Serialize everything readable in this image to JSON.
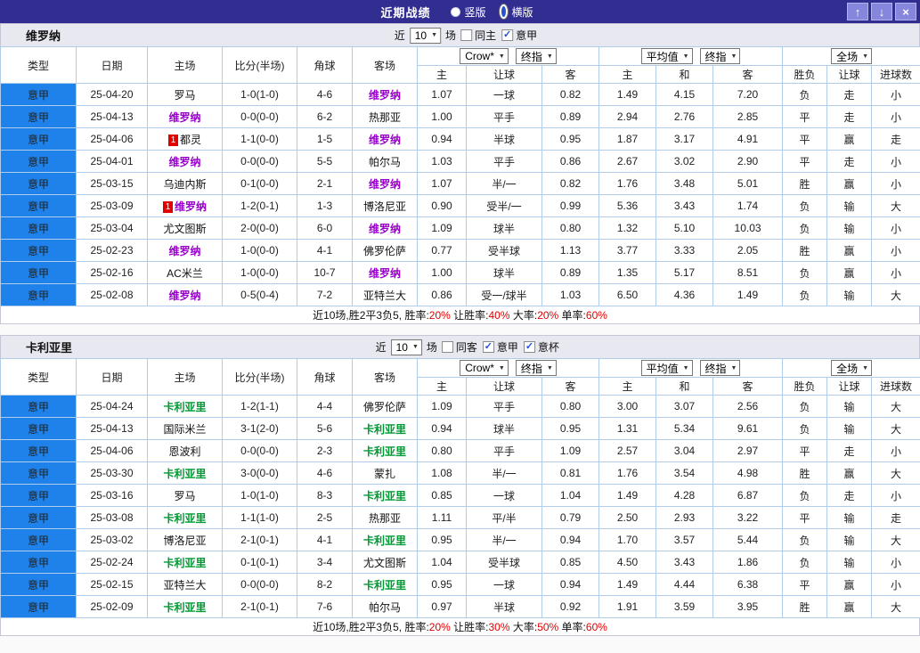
{
  "top_bar": {
    "title": "近期战绩",
    "view_options": [
      {
        "label": "竖版",
        "selected": false
      },
      {
        "label": "横版",
        "selected": true
      }
    ],
    "buttons": {
      "up": "↑",
      "down": "↓",
      "close": "×"
    }
  },
  "columns": [
    "类型",
    "日期",
    "主场",
    "比分(半场)",
    "角球",
    "客场"
  ],
  "subcols": [
    "主",
    "让球",
    "客",
    "主",
    "和",
    "客",
    "胜负",
    "让球",
    "进球数"
  ],
  "selects": {
    "bookmaker": "Crow*",
    "final": "终指",
    "average": "平均值",
    "full": "全场"
  },
  "colors": {
    "accent_blue": "#1e82ea",
    "score_red": "#e10000",
    "result_blue": "#2c46c8",
    "result_gold": "#c79100",
    "topbar": "#322e91"
  },
  "sections": [
    {
      "team": "维罗纳",
      "team_color": "#9900cc",
      "filter": {
        "prefix": "近",
        "count": "10",
        "suffix": "场",
        "checks": [
          {
            "label": "同主",
            "checked": false
          },
          {
            "label": "意甲",
            "checked": true
          }
        ]
      },
      "rows": [
        {
          "league": "意甲",
          "date": "25-04-20",
          "home": {
            "n": "罗马"
          },
          "score": "1-0(1-0)",
          "corner": "4-6",
          "away": {
            "n": "维罗纳",
            "hl": true
          },
          "asian": [
            "1.07",
            "一球",
            "0.82"
          ],
          "euro": [
            "1.49",
            "4.15",
            "7.20"
          ],
          "res": [
            [
              "负",
              "b"
            ],
            [
              "走",
              "b"
            ],
            [
              "小",
              "b"
            ]
          ]
        },
        {
          "league": "意甲",
          "date": "25-04-13",
          "home": {
            "n": "维罗纳",
            "hl": true
          },
          "score": "0-0(0-0)",
          "corner": "6-2",
          "away": {
            "n": "热那亚"
          },
          "asian": [
            "1.00",
            "平手",
            "0.89"
          ],
          "euro": [
            "2.94",
            "2.76",
            "2.85"
          ],
          "res": [
            [
              "平",
              "b"
            ],
            [
              "走",
              "b"
            ],
            [
              "小",
              "b"
            ]
          ]
        },
        {
          "league": "意甲",
          "date": "25-04-06",
          "home": {
            "n": "都灵",
            "badge": "1"
          },
          "score": "1-1(0-0)",
          "corner": "1-5",
          "away": {
            "n": "维罗纳",
            "hl": true
          },
          "asian": [
            "0.94",
            "半球",
            "0.95"
          ],
          "euro": [
            "1.87",
            "3.17",
            "4.91"
          ],
          "res": [
            [
              "平",
              "b"
            ],
            [
              "赢",
              "r"
            ],
            [
              "走",
              "g"
            ]
          ]
        },
        {
          "league": "意甲",
          "date": "25-04-01",
          "home": {
            "n": "维罗纳",
            "hl": true
          },
          "score": "0-0(0-0)",
          "corner": "5-5",
          "away": {
            "n": "帕尔马"
          },
          "asian": [
            "1.03",
            "平手",
            "0.86"
          ],
          "euro": [
            "2.67",
            "3.02",
            "2.90"
          ],
          "res": [
            [
              "平",
              "b"
            ],
            [
              "走",
              "b"
            ],
            [
              "小",
              "b"
            ]
          ]
        },
        {
          "league": "意甲",
          "date": "25-03-15",
          "home": {
            "n": "乌迪内斯"
          },
          "score": "0-1(0-0)",
          "corner": "2-1",
          "away": {
            "n": "维罗纳",
            "hl": true
          },
          "asian": [
            "1.07",
            "半/一",
            "0.82"
          ],
          "euro": [
            "1.76",
            "3.48",
            "5.01"
          ],
          "res": [
            [
              "胜",
              "r"
            ],
            [
              "赢",
              "r"
            ],
            [
              "小",
              "b"
            ]
          ]
        },
        {
          "league": "意甲",
          "date": "25-03-09",
          "home": {
            "n": "维罗纳",
            "hl": true,
            "badge": "1"
          },
          "score": "1-2(0-1)",
          "corner": "1-3",
          "away": {
            "n": "博洛尼亚"
          },
          "asian": [
            "0.90",
            "受半/一",
            "0.99"
          ],
          "euro": [
            "5.36",
            "3.43",
            "1.74"
          ],
          "res": [
            [
              "负",
              "b"
            ],
            [
              "输",
              "g"
            ],
            [
              "大",
              "r"
            ]
          ]
        },
        {
          "league": "意甲",
          "date": "25-03-04",
          "home": {
            "n": "尤文图斯"
          },
          "score": "2-0(0-0)",
          "corner": "6-0",
          "away": {
            "n": "维罗纳",
            "hl": true
          },
          "asian": [
            "1.09",
            "球半",
            "0.80"
          ],
          "euro": [
            "1.32",
            "5.10",
            "10.03"
          ],
          "res": [
            [
              "负",
              "b"
            ],
            [
              "输",
              "g"
            ],
            [
              "小",
              "b"
            ]
          ]
        },
        {
          "league": "意甲",
          "date": "25-02-23",
          "home": {
            "n": "维罗纳",
            "hl": true
          },
          "score": "1-0(0-0)",
          "corner": "4-1",
          "away": {
            "n": "佛罗伦萨"
          },
          "asian": [
            "0.77",
            "受半球",
            "1.13"
          ],
          "euro": [
            "3.77",
            "3.33",
            "2.05"
          ],
          "res": [
            [
              "胜",
              "r"
            ],
            [
              "赢",
              "r"
            ],
            [
              "小",
              "b"
            ]
          ]
        },
        {
          "league": "意甲",
          "date": "25-02-16",
          "home": {
            "n": "AC米兰"
          },
          "score": "1-0(0-0)",
          "corner": "10-7",
          "away": {
            "n": "维罗纳",
            "hl": true
          },
          "asian": [
            "1.00",
            "球半",
            "0.89"
          ],
          "euro": [
            "1.35",
            "5.17",
            "8.51"
          ],
          "res": [
            [
              "负",
              "b"
            ],
            [
              "赢",
              "r"
            ],
            [
              "小",
              "b"
            ]
          ]
        },
        {
          "league": "意甲",
          "date": "25-02-08",
          "home": {
            "n": "维罗纳",
            "hl": true
          },
          "score": "0-5(0-4)",
          "corner": "7-2",
          "away": {
            "n": "亚特兰大"
          },
          "asian": [
            "0.86",
            "受一/球半",
            "1.03"
          ],
          "euro": [
            "6.50",
            "4.36",
            "1.49"
          ],
          "res": [
            [
              "负",
              "b"
            ],
            [
              "输",
              "g"
            ],
            [
              "大",
              "r"
            ]
          ]
        }
      ],
      "summary": [
        [
          "近10场,胜2平3负5, ",
          "d"
        ],
        [
          "胜率:",
          "d"
        ],
        [
          "20%",
          "r"
        ],
        [
          " 让胜率:",
          "d"
        ],
        [
          "40%",
          "r"
        ],
        [
          " 大率:",
          "d"
        ],
        [
          "20%",
          "r"
        ],
        [
          " 单率:",
          "d"
        ],
        [
          "60%",
          "r"
        ]
      ]
    },
    {
      "team": "卡利亚里",
      "team_color": "#009933",
      "filter": {
        "prefix": "近",
        "count": "10",
        "suffix": "场",
        "checks": [
          {
            "label": "同客",
            "checked": false
          },
          {
            "label": "意甲",
            "checked": true
          },
          {
            "label": "意杯",
            "checked": true
          }
        ]
      },
      "rows": [
        {
          "league": "意甲",
          "date": "25-04-24",
          "home": {
            "n": "卡利亚里",
            "hl": true
          },
          "score": "1-2(1-1)",
          "corner": "4-4",
          "away": {
            "n": "佛罗伦萨"
          },
          "asian": [
            "1.09",
            "平手",
            "0.80"
          ],
          "euro": [
            "3.00",
            "3.07",
            "2.56"
          ],
          "res": [
            [
              "负",
              "b"
            ],
            [
              "输",
              "g"
            ],
            [
              "大",
              "r"
            ]
          ]
        },
        {
          "league": "意甲",
          "date": "25-04-13",
          "home": {
            "n": "国际米兰"
          },
          "score": "3-1(2-0)",
          "corner": "5-6",
          "away": {
            "n": "卡利亚里",
            "hl": true
          },
          "asian": [
            "0.94",
            "球半",
            "0.95"
          ],
          "euro": [
            "1.31",
            "5.34",
            "9.61"
          ],
          "res": [
            [
              "负",
              "b"
            ],
            [
              "输",
              "g"
            ],
            [
              "大",
              "r"
            ]
          ]
        },
        {
          "league": "意甲",
          "date": "25-04-06",
          "home": {
            "n": "恩波利"
          },
          "score": "0-0(0-0)",
          "corner": "2-3",
          "away": {
            "n": "卡利亚里",
            "hl": true
          },
          "asian": [
            "0.80",
            "平手",
            "1.09"
          ],
          "euro": [
            "2.57",
            "3.04",
            "2.97"
          ],
          "res": [
            [
              "平",
              "b"
            ],
            [
              "走",
              "b"
            ],
            [
              "小",
              "b"
            ]
          ]
        },
        {
          "league": "意甲",
          "date": "25-03-30",
          "home": {
            "n": "卡利亚里",
            "hl": true
          },
          "score": "3-0(0-0)",
          "corner": "4-6",
          "away": {
            "n": "蒙扎"
          },
          "asian": [
            "1.08",
            "半/一",
            "0.81"
          ],
          "euro": [
            "1.76",
            "3.54",
            "4.98"
          ],
          "res": [
            [
              "胜",
              "r"
            ],
            [
              "赢",
              "r"
            ],
            [
              "大",
              "r"
            ]
          ]
        },
        {
          "league": "意甲",
          "date": "25-03-16",
          "home": {
            "n": "罗马"
          },
          "score": "1-0(1-0)",
          "corner": "8-3",
          "away": {
            "n": "卡利亚里",
            "hl": true
          },
          "asian": [
            "0.85",
            "一球",
            "1.04"
          ],
          "euro": [
            "1.49",
            "4.28",
            "6.87"
          ],
          "res": [
            [
              "负",
              "b"
            ],
            [
              "走",
              "b"
            ],
            [
              "小",
              "b"
            ]
          ]
        },
        {
          "league": "意甲",
          "date": "25-03-08",
          "home": {
            "n": "卡利亚里",
            "hl": true
          },
          "score": "1-1(1-0)",
          "corner": "2-5",
          "away": {
            "n": "热那亚"
          },
          "asian": [
            "1.11",
            "平/半",
            "0.79"
          ],
          "euro": [
            "2.50",
            "2.93",
            "3.22"
          ],
          "res": [
            [
              "平",
              "b"
            ],
            [
              "输",
              "g"
            ],
            [
              "走",
              "g"
            ]
          ]
        },
        {
          "league": "意甲",
          "date": "25-03-02",
          "home": {
            "n": "博洛尼亚"
          },
          "score": "2-1(0-1)",
          "corner": "4-1",
          "away": {
            "n": "卡利亚里",
            "hl": true
          },
          "asian": [
            "0.95",
            "半/一",
            "0.94"
          ],
          "euro": [
            "1.70",
            "3.57",
            "5.44"
          ],
          "res": [
            [
              "负",
              "b"
            ],
            [
              "输",
              "g"
            ],
            [
              "大",
              "r"
            ]
          ]
        },
        {
          "league": "意甲",
          "date": "25-02-24",
          "home": {
            "n": "卡利亚里",
            "hl": true
          },
          "score": "0-1(0-1)",
          "corner": "3-4",
          "away": {
            "n": "尤文图斯"
          },
          "asian": [
            "1.04",
            "受半球",
            "0.85"
          ],
          "euro": [
            "4.50",
            "3.43",
            "1.86"
          ],
          "res": [
            [
              "负",
              "b"
            ],
            [
              "输",
              "g"
            ],
            [
              "小",
              "b"
            ]
          ]
        },
        {
          "league": "意甲",
          "date": "25-02-15",
          "home": {
            "n": "亚特兰大"
          },
          "score": "0-0(0-0)",
          "corner": "8-2",
          "away": {
            "n": "卡利亚里",
            "hl": true
          },
          "asian": [
            "0.95",
            "一球",
            "0.94"
          ],
          "euro": [
            "1.49",
            "4.44",
            "6.38"
          ],
          "res": [
            [
              "平",
              "b"
            ],
            [
              "赢",
              "r"
            ],
            [
              "小",
              "b"
            ]
          ]
        },
        {
          "league": "意甲",
          "date": "25-02-09",
          "home": {
            "n": "卡利亚里",
            "hl": true
          },
          "score": "2-1(0-1)",
          "corner": "7-6",
          "away": {
            "n": "帕尔马"
          },
          "asian": [
            "0.97",
            "半球",
            "0.92"
          ],
          "euro": [
            "1.91",
            "3.59",
            "3.95"
          ],
          "res": [
            [
              "胜",
              "r"
            ],
            [
              "赢",
              "r"
            ],
            [
              "大",
              "r"
            ]
          ]
        }
      ],
      "summary": [
        [
          "近10场,胜2平3负5, ",
          "d"
        ],
        [
          "胜率:",
          "d"
        ],
        [
          "20%",
          "r"
        ],
        [
          " 让胜率:",
          "d"
        ],
        [
          "30%",
          "r"
        ],
        [
          " 大率:",
          "d"
        ],
        [
          "50%",
          "r"
        ],
        [
          " 单率:",
          "d"
        ],
        [
          "60%",
          "r"
        ]
      ]
    }
  ]
}
